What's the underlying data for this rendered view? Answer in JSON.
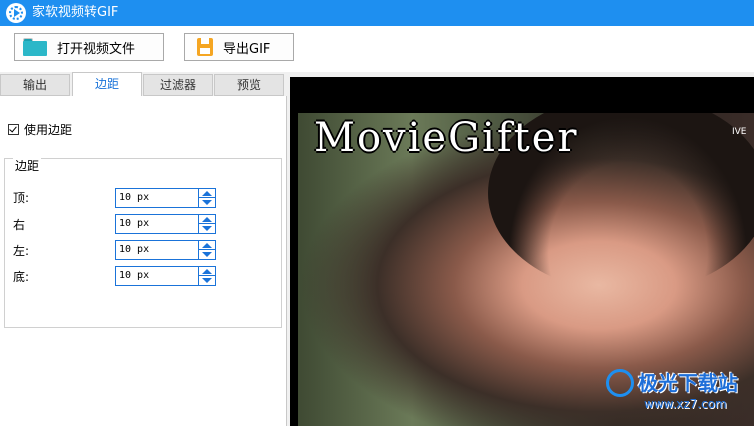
{
  "app": {
    "title": "家软视频转GIF",
    "icon": "app-play-icon",
    "accent": "#1e8ff0"
  },
  "toolbar": {
    "open_label": "打开视频文件",
    "export_label": "导出GIF"
  },
  "tabs": [
    {
      "label": "输出",
      "active": false
    },
    {
      "label": "边距",
      "active": true
    },
    {
      "label": "过滤器",
      "active": false
    },
    {
      "label": "预览",
      "active": false
    }
  ],
  "margin_panel": {
    "use_margin_label": "使用边距",
    "use_margin_checked": true,
    "group_title": "边距",
    "fields": [
      {
        "label": "顶:",
        "value": "10 px"
      },
      {
        "label": "右",
        "value": "10 px"
      },
      {
        "label": "左:",
        "value": "10 px"
      },
      {
        "label": "底:",
        "value": "10 px"
      }
    ]
  },
  "preview": {
    "watermark_text": "MovieGifter",
    "corner_badge": "IVE",
    "site_logo_name": "极光下载站",
    "site_logo_url": "www.xz7.com"
  }
}
